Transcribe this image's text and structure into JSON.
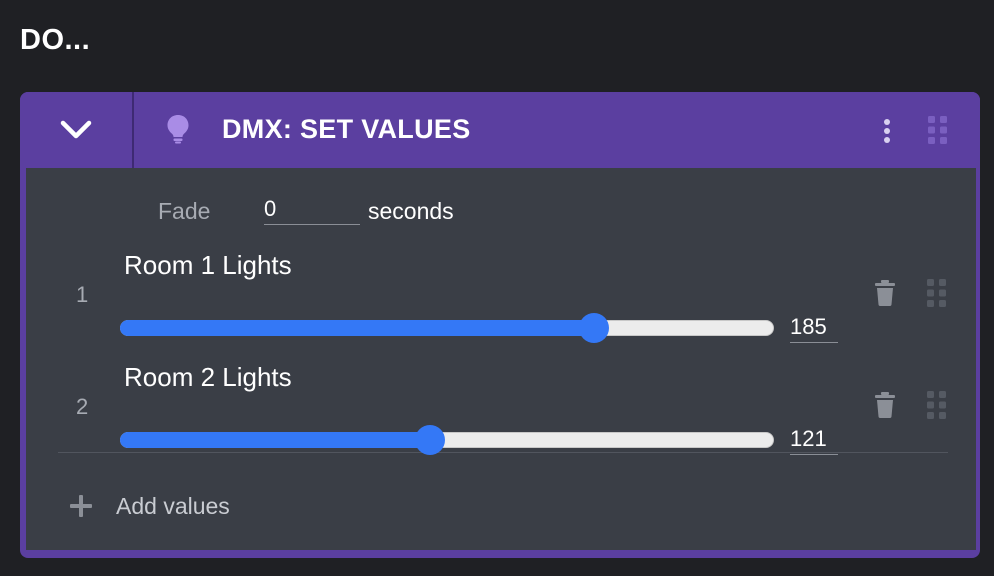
{
  "section": {
    "title": "DO..."
  },
  "card": {
    "title": "DMX: SET VALUES",
    "accent_color": "#5b3fa0",
    "icons": {
      "collapse": "chevron-down-icon",
      "type": "lightbulb-icon",
      "menu": "kebab-menu-icon",
      "drag": "drag-handle-icon"
    }
  },
  "fade": {
    "label": "Fade",
    "value": "0",
    "unit": "seconds"
  },
  "rows": [
    {
      "index": "1",
      "name": "Room 1 Lights",
      "value": "185",
      "level": 185,
      "max": 255
    },
    {
      "index": "2",
      "name": "Room 2 Lights",
      "value": "121",
      "level": 121,
      "max": 255
    }
  ],
  "add": {
    "label": "Add values"
  },
  "slider_color": "#3478f6"
}
